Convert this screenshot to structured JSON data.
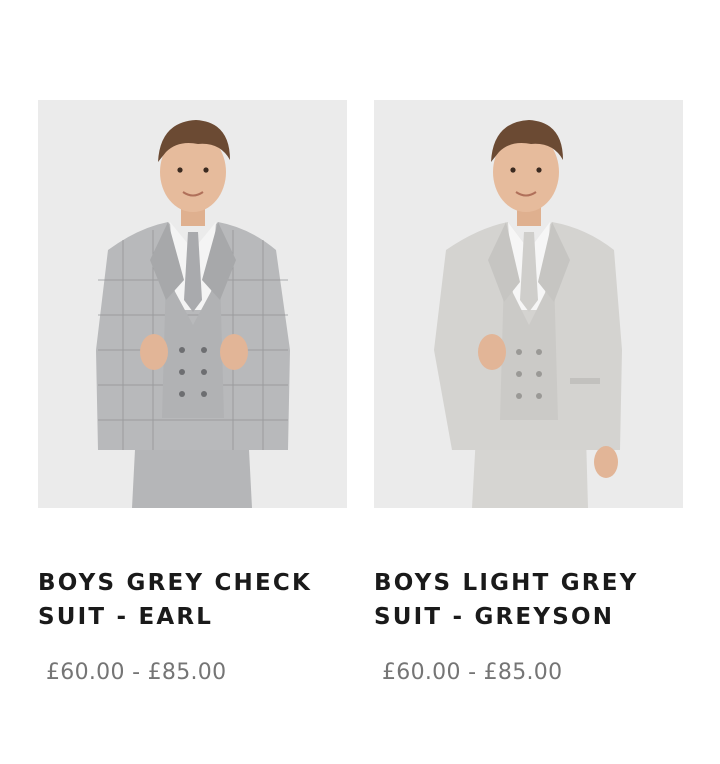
{
  "products": [
    {
      "title": "BOYS GREY CHECK SUIT - EARL",
      "price": "£60.00 - £85.00",
      "image_alt": "Boys grey check suit",
      "colors": {
        "suit": "#b8b9bb",
        "check": "#8f9093",
        "shirt": "#f4f4f4",
        "tie": "#a9aaad"
      }
    },
    {
      "title": "BOYS LIGHT GREY SUIT - GREYSON",
      "price": "£60.00 - £85.00",
      "image_alt": "Boys light grey suit",
      "colors": {
        "suit": "#d4d3d0",
        "check": "#c2c1be",
        "shirt": "#f6f6f6",
        "tie": "#cfcecb"
      }
    }
  ]
}
